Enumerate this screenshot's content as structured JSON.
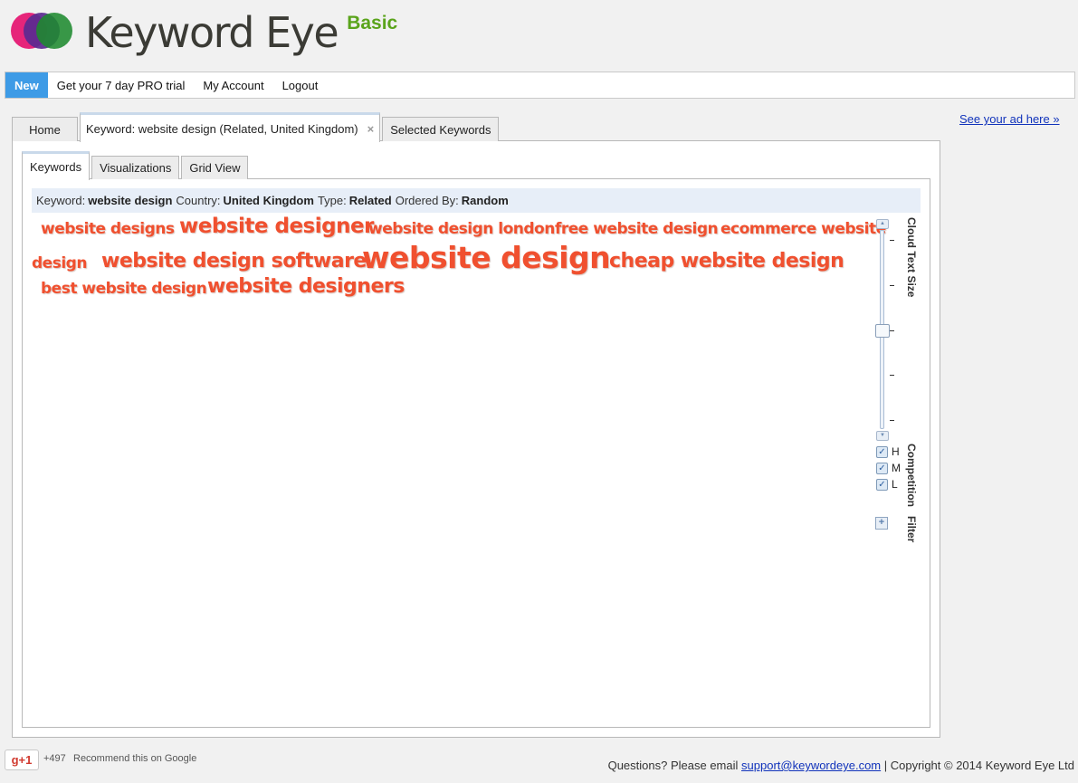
{
  "logo": {
    "brand": "Keyword Eye",
    "badge": "Basic"
  },
  "nav": {
    "new": "New",
    "items": [
      "Get your 7 day PRO trial",
      "My Account",
      "Logout"
    ]
  },
  "ad_link": "See your ad here »",
  "outer_tabs": {
    "home": "Home",
    "keyword": "Keyword: website design (Related, United Kingdom)",
    "close": "×",
    "selected": "Selected Keywords"
  },
  "inner_tabs": [
    "Keywords",
    "Visualizations",
    "Grid View"
  ],
  "info": {
    "keyword_label": "Keyword:",
    "keyword": "website design",
    "country_label": "Country:",
    "country": "United Kingdom",
    "type_label": "Type:",
    "type": "Related",
    "order_label": "Ordered By:",
    "order": "Random"
  },
  "cloud_words": [
    "website designs",
    "website designer",
    "website design london",
    "free website design",
    "ecommerce website",
    "design",
    "website design software",
    "website design",
    "cheap website design",
    "best website design",
    "website designers"
  ],
  "sidebar": {
    "cloud_text_size_label": "Cloud Text Size",
    "competition_label": "Competition",
    "filter_label": "Filter",
    "filters": [
      {
        "label": "H",
        "checked": true
      },
      {
        "label": "M",
        "checked": true
      },
      {
        "label": "L",
        "checked": true
      }
    ]
  },
  "footer": {
    "gplus": "g+1",
    "count": "+497",
    "recommend": "Recommend this on Google",
    "questions": "Questions? Please email",
    "email": "support@keywordeye.com",
    "copyright": "| Copyright © 2014 Keyword Eye Ltd"
  },
  "colors": {
    "cloud_word": "#f0502f",
    "nav_new": "#3e9be6",
    "badge": "#5aa41b",
    "link": "#1133bb"
  }
}
